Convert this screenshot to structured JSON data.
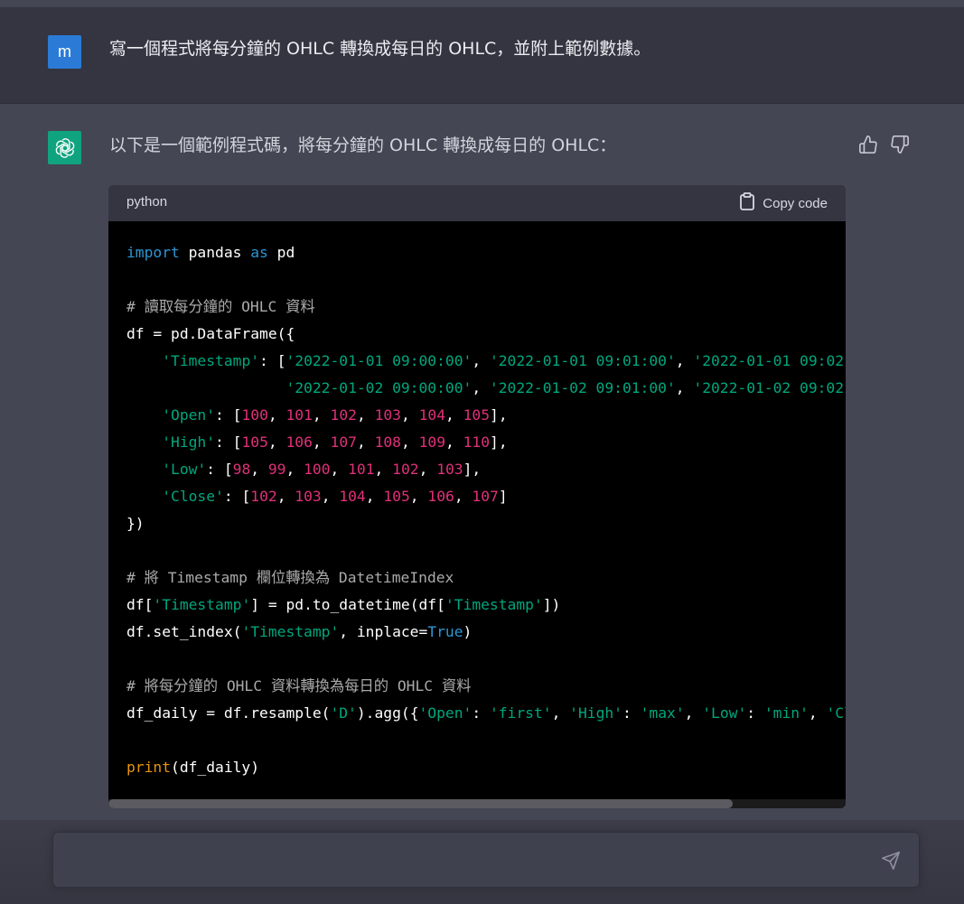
{
  "user_message": {
    "avatar_letter": "m",
    "text": "寫一個程式將每分鐘的 OHLC 轉換成每日的 OHLC，並附上範例數據。"
  },
  "assistant_message": {
    "intro": "以下是一個範例程式碼，將每分鐘的 OHLC 轉換成每日的 OHLC：",
    "code_block": {
      "language": "python",
      "copy_label": "Copy code"
    }
  },
  "icons": {
    "user_avatar": "letter-avatar",
    "assistant_avatar": "openai-logo-icon",
    "like": "thumbs-up-icon",
    "dislike": "thumbs-down-icon",
    "copy": "clipboard-icon",
    "send": "paper-plane-icon"
  },
  "colors": {
    "user_bg": "#343541",
    "assistant_bg": "#444654",
    "user_avatar": "#2b7bd6",
    "assistant_avatar": "#10a37f",
    "code_bg": "#000000"
  },
  "input": {
    "placeholder": ""
  }
}
